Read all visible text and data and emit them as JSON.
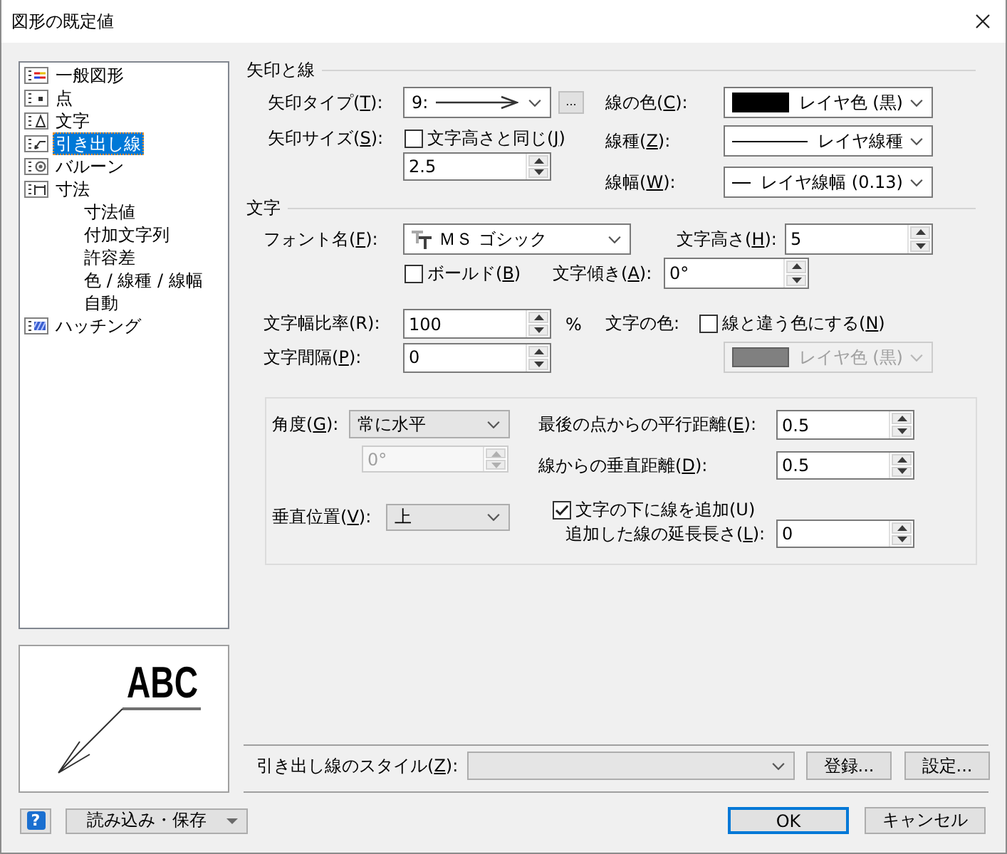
{
  "window": {
    "title": "図形の既定値"
  },
  "tree": [
    {
      "kind": "general",
      "label": "一般図形",
      "selected": false
    },
    {
      "kind": "point",
      "label": "点",
      "selected": false
    },
    {
      "kind": "text",
      "label": "文字",
      "selected": false
    },
    {
      "kind": "leader",
      "label": "引き出し線",
      "selected": true
    },
    {
      "kind": "balloon",
      "label": "バルーン",
      "selected": false
    },
    {
      "kind": "dimension",
      "label": "寸法",
      "selected": false,
      "children": [
        {
          "label": "寸法値",
          "selected": false
        },
        {
          "label": "付加文字列",
          "selected": false
        },
        {
          "label": "許容差",
          "selected": false
        },
        {
          "label": "色 / 線種 / 線幅",
          "selected": false
        },
        {
          "label": "自動",
          "selected": false
        }
      ]
    },
    {
      "kind": "hatching",
      "label": "ハッチング",
      "selected": false
    }
  ],
  "preview": {
    "text": "ABC"
  },
  "arrow_and_line": {
    "heading": "矢印と線",
    "arrow_type": {
      "label": "矢印タイプ(T):",
      "access_key_underlined": true,
      "value": "9:"
    },
    "arrow_button": "...",
    "arrow_size": {
      "label": "矢印サイズ(S):",
      "access_key_underlined": true,
      "value": "2.5"
    },
    "same_as_text_height": {
      "label": "文字高さと同じ(J)",
      "access_key_underlined": true,
      "checked": false
    },
    "line_color": {
      "label": "線の色(C):",
      "access_key_underlined": true,
      "value": "レイヤ色 (黒)"
    },
    "line_type": {
      "label": "線種(Z):",
      "access_key_underlined": true,
      "value": "レイヤ線種"
    },
    "line_width": {
      "label": "線幅(W):",
      "access_key_underlined": true,
      "value": "レイヤ線幅 (0.13)"
    }
  },
  "text": {
    "heading": "文字",
    "font": {
      "label": "フォント名(F):",
      "access_key_underlined": true,
      "value": "ＭＳ ゴシック"
    },
    "text_height": {
      "label": "文字高さ(H):",
      "access_key_underlined": true,
      "value": "5"
    },
    "bold": {
      "label": "ボールド(B)",
      "access_key_underlined": true,
      "checked": false
    },
    "slant": {
      "label": "文字傾き(A):",
      "access_key_underlined": true,
      "value": "0°"
    },
    "width_ratio": {
      "label": "文字幅比率(R):",
      "access_key_underlined": false,
      "value": "100",
      "unit": "%"
    },
    "spacing": {
      "label": "文字間隔(P):",
      "access_key_underlined": true,
      "value": "0"
    },
    "text_color": {
      "label": "文字の色:"
    },
    "different_color": {
      "label": "線と違う色にする(N)",
      "access_key_underlined": true,
      "checked": false
    },
    "color_combo": {
      "value": "レイヤ色 (黒)",
      "disabled": true
    }
  },
  "placement": {
    "angle": {
      "label": "角度(G):",
      "access_key_underlined": true,
      "value": "常に水平"
    },
    "angle_value": {
      "value": "0°",
      "disabled": true
    },
    "vertical_position": {
      "label": "垂直位置(V):",
      "access_key_underlined": true,
      "value": "上"
    },
    "parallel_distance": {
      "label": "最後の点からの平行距離(E):",
      "access_key_underlined": true,
      "value": "0.5"
    },
    "perpendicular_distance": {
      "label": "線からの垂直距離(D):",
      "access_key_underlined": true,
      "value": "0.5"
    },
    "underline": {
      "label": "文字の下に線を追加(U)",
      "access_key_underlined": false,
      "checked": true
    },
    "extension_length": {
      "label": "追加した線の延長長さ(L):",
      "access_key_underlined": true,
      "value": "0"
    }
  },
  "style": {
    "label": "引き出し線のスタイル(Z):",
    "access_key_underlined": true,
    "register_button": "登録...",
    "settings_button": "設定..."
  },
  "footer": {
    "help": "?",
    "load_save": "読み込み・保存",
    "buttons": [
      {
        "label": "OK",
        "default": true
      },
      {
        "label": "キャンセル",
        "default": false
      }
    ]
  }
}
